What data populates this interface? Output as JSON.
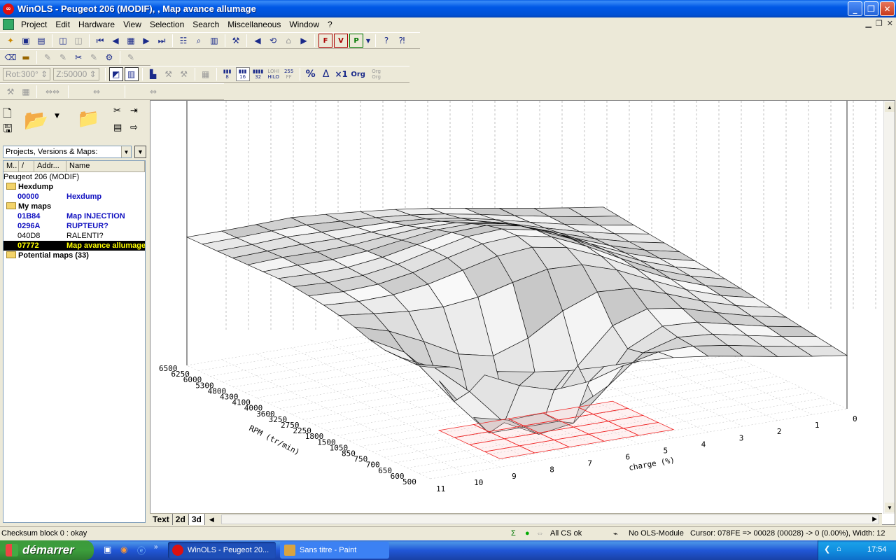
{
  "window": {
    "title": "WinOLS - Peugeot 206 (MODIF), , Map avance allumage"
  },
  "menu": [
    "Project",
    "Edit",
    "Hardware",
    "View",
    "Selection",
    "Search",
    "Miscellaneous",
    "Window",
    "?"
  ],
  "toolbar3": {
    "rot": "Rot:300°",
    "zoom": "Z:50000"
  },
  "tb3_labels": {
    "b8": "8",
    "b16": "16",
    "b32": "32",
    "lohi_top": "LOHI",
    "lohi_bot": "HILO",
    "n255": "255",
    "ff": "FF",
    "pct": "%",
    "x1": "×1",
    "org": "Org",
    "org2a": "Org",
    "org2b": "Org"
  },
  "left": {
    "combo": "Projects, Versions & Maps:",
    "columns": [
      "M..",
      "/",
      "Addr...",
      "Name"
    ],
    "project": "Peugeot 206 (MODIF)",
    "tree": [
      {
        "type": "folder",
        "label": "Hexdump"
      },
      {
        "type": "item",
        "addr": "00000",
        "name": "Hexdump",
        "style": "blue"
      },
      {
        "type": "folder",
        "label": "My maps"
      },
      {
        "type": "item",
        "addr": "01B84",
        "name": "Map INJECTION",
        "style": "blue"
      },
      {
        "type": "item",
        "addr": "0296A",
        "name": "RUPTEUR?",
        "style": "blue"
      },
      {
        "type": "item",
        "addr": "040D8",
        "name": "RALENTI?",
        "style": "plain"
      },
      {
        "type": "item",
        "addr": "07772",
        "name": "Map avance allumage",
        "style": "selected"
      },
      {
        "type": "folder",
        "label": "Potential maps (33)"
      }
    ]
  },
  "plot": {
    "rpm_label": "RPM (tr/min)",
    "rpm_ticks": [
      "6500",
      "6250",
      "6000",
      "5300",
      "4800",
      "4300",
      "4100",
      "4000",
      "3600",
      "3250",
      "2750",
      "2250",
      "1800",
      "1500",
      "1050",
      "850",
      "750",
      "700",
      "650",
      "600",
      "500"
    ],
    "charge_label": "charge (%)",
    "charge_ticks": [
      "0",
      "1",
      "2",
      "3",
      "4",
      "5",
      "6",
      "7",
      "8",
      "9",
      "10",
      "11"
    ]
  },
  "view_tabs": [
    "Text",
    "2d",
    "3d"
  ],
  "status": {
    "left": "Checksum block 0 : okay",
    "cs": "All CS ok",
    "module": "No OLS-Module",
    "cursor": "Cursor: 078FE => 00028 (00028) -> 0 (0.00%), Width: 12"
  },
  "taskbar": {
    "start": "démarrer",
    "tasks": [
      "WinOLS - Peugeot 20...",
      "Sans titre - Paint"
    ],
    "lang": "FR",
    "clock": "17:54"
  }
}
